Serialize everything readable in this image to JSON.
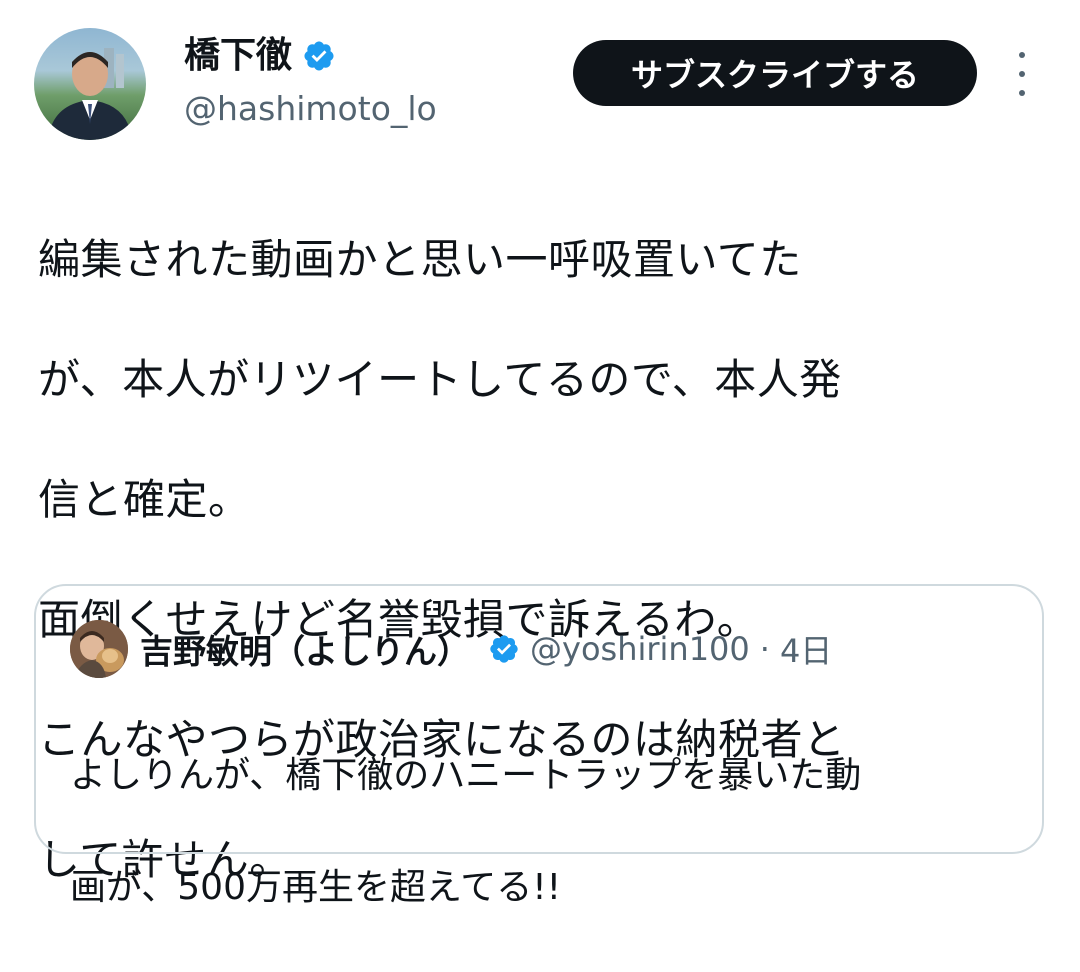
{
  "author": {
    "display_name": "橋下徹",
    "handle": "@hashimoto_lo",
    "verified": true
  },
  "subscribe_label": "サブスクライブする",
  "tweet_text": "編集された動画かと思い一呼吸置いてたが、本人がリツイートしてるので、本人発信と確定。\n面倒くせえけど名誉毀損で訴えるわ。\nこんなやつらが政治家になるのは納税者として許せん。",
  "tweet_text_lines": [
    "編集された動画かと思い一呼吸置いてた",
    "が、本人がリツイートしてるので、本人発",
    "信と確定。",
    "面倒くせえけど名誉毀損で訴えるわ。",
    "こんなやつらが政治家になるのは納税者と",
    "して許せん。"
  ],
  "quote": {
    "display_name": "吉野敏明（よしりん）",
    "handle": "@yoshirin100",
    "separator": "·",
    "time": "4日",
    "verified": true,
    "text_lines": [
      "よしりんが、橋下徹のハニートラップを暴いた動",
      "画が、500万再生を超えてる!!"
    ]
  },
  "colors": {
    "text": "#0f1419",
    "secondary_text": "#536471",
    "verified_blue": "#1d9bf0",
    "button_bg": "#0f1419",
    "border": "#cfd9de"
  },
  "icons": [
    "verified-badge-icon",
    "more-options-icon"
  ]
}
